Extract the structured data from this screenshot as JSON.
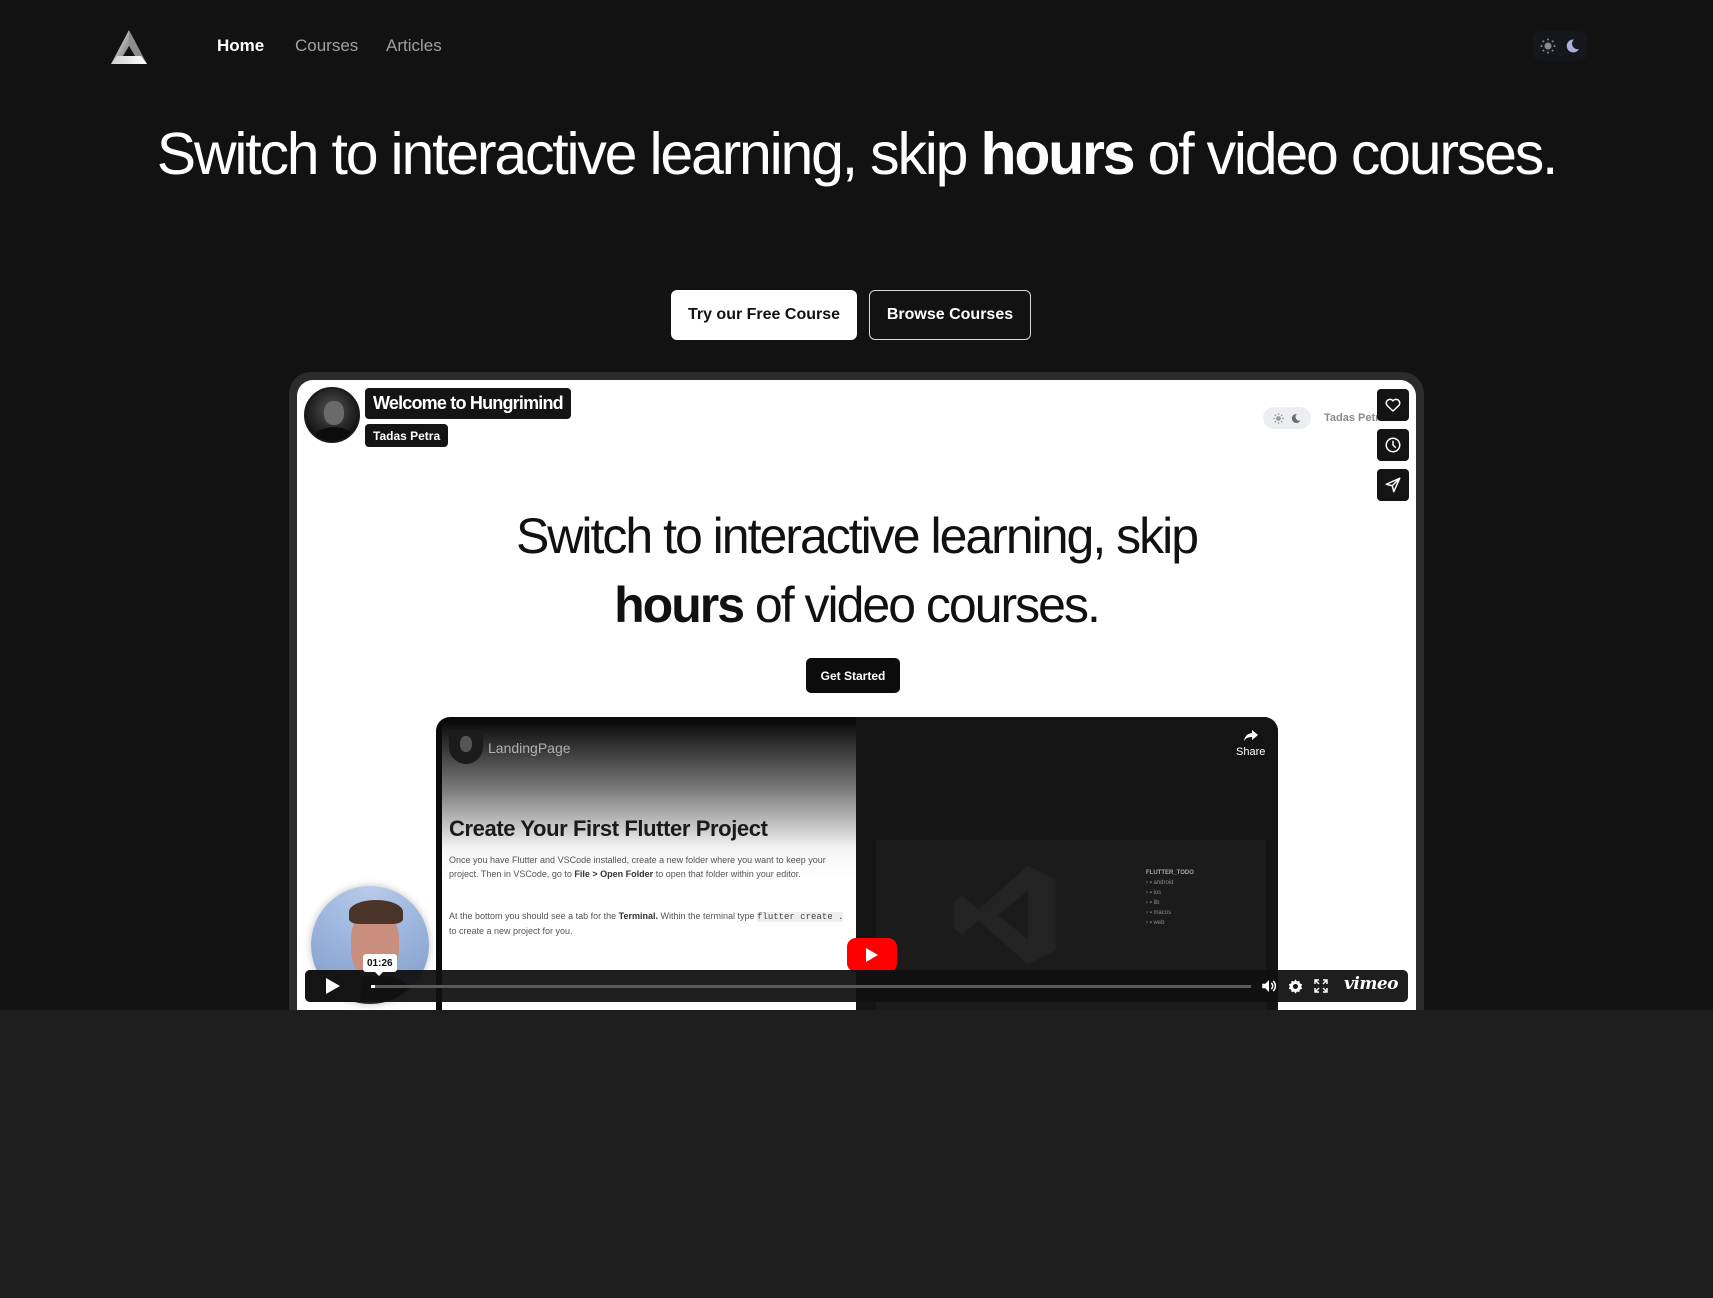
{
  "nav": {
    "logo": "hungrimind-triangle-logo",
    "links": [
      {
        "label": "Home",
        "active": true
      },
      {
        "label": "Courses",
        "active": false
      },
      {
        "label": "Articles",
        "active": false
      }
    ],
    "theme_toggle": {
      "icons": [
        "sun-icon",
        "moon-icon"
      ]
    }
  },
  "hero": {
    "title_part1": "Switch to interactive learning, skip ",
    "title_bold": "hours",
    "title_part2": " of video courses.",
    "primary_button": "Try our Free Course",
    "secondary_button": "Browse Courses"
  },
  "video": {
    "title": "Welcome to Hungrimind",
    "author": "Tadas Petra",
    "side_actions": [
      "like",
      "watch-later",
      "share"
    ],
    "inner_page": {
      "author": "Tadas Petra",
      "title_part1": "Switch to interactive learning, skip",
      "title_bold": "hours",
      "title_part2": " of video courses.",
      "cta": "Get Started",
      "embed": {
        "channel": "LandingPage",
        "share_label": "Share",
        "doc_title": "Create Your First Flutter Project",
        "para1_a": "Once you have Flutter and VSCode installed, create a new folder where you want to keep your project. Then in VSCode, go to ",
        "para1_b": "File > Open Folder",
        "para1_c": " to open that folder within your editor.",
        "para2_a": "At the bottom you should see a tab for the ",
        "para2_b": "Terminal.",
        "para2_c": " Within the terminal type ",
        "para2_code": "flutter create .",
        "para2_d": " to create a new project for you.",
        "explorer_title": "FLUTTER_TODO",
        "explorer_items": [
          "android",
          "ios",
          "lib",
          "macos",
          "web"
        ]
      }
    },
    "player": {
      "current_time": "01:26",
      "progress": 0.005,
      "brand": "vimeo"
    }
  }
}
